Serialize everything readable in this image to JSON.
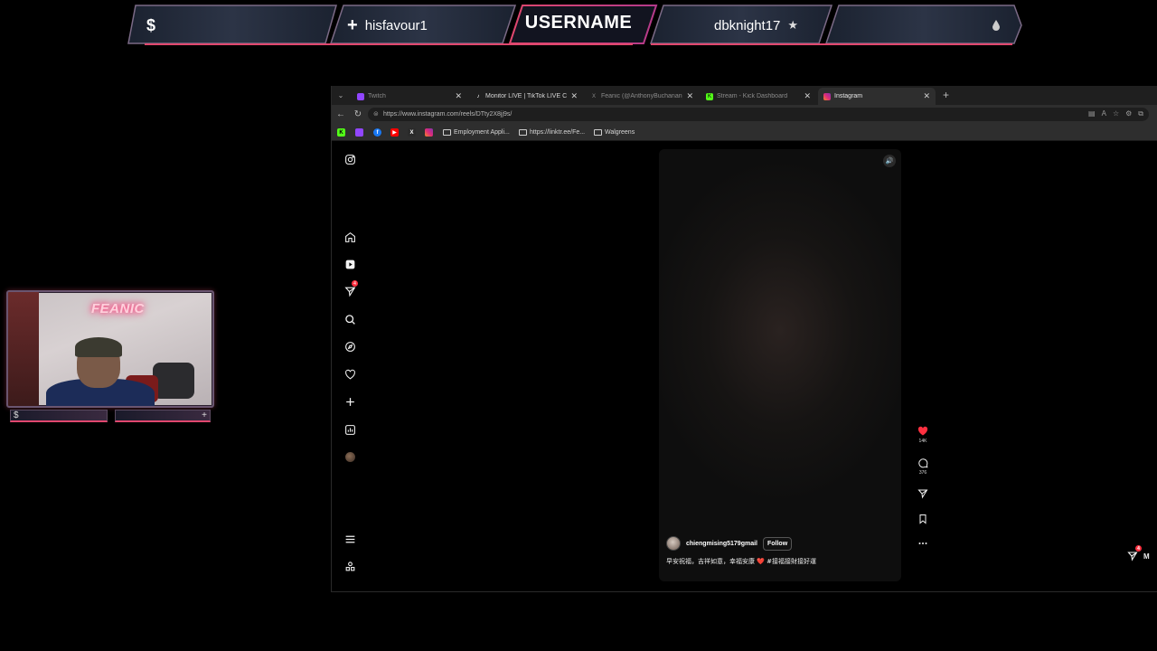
{
  "overlay": {
    "left_icon": "$",
    "follower_prefix": "+",
    "follower_name": "hisfavour1",
    "username": "USERNAME",
    "subscriber_name": "dbknight17",
    "subscriber_icon": "★",
    "right_icon": "💧"
  },
  "webcam": {
    "neon_sign": "FEANIC",
    "footer_left_icon": "$",
    "footer_right_icon": "+"
  },
  "browser": {
    "tabs": [
      {
        "label": "Twitch",
        "favicon": "twitch-icon",
        "fav_color": "#9146ff"
      },
      {
        "label": "Monitor LIVE | TikTok LIVE Center",
        "favicon": "tiktok-icon",
        "fav_color": "#ffffff"
      },
      {
        "label": "Feanic (@AnthonyBuchanan) / X",
        "favicon": "x-icon",
        "fav_color": "#888888"
      },
      {
        "label": "Stream - Kick Dashboard",
        "favicon": "kick-icon",
        "fav_color": "#53fc18"
      },
      {
        "label": "Instagram",
        "favicon": "instagram-icon",
        "fav_color": "#e1306c"
      }
    ],
    "new_tab": "+",
    "url": "https://www.instagram.com/reels/DTty2X8jj9s/",
    "bookmarks": {
      "folders": [
        "Employment Appli...",
        "https://linktr.ee/Fe...",
        "Walgreens"
      ]
    }
  },
  "instagram": {
    "reel": {
      "username": "chiengmising5179gmail",
      "follow_label": "Follow",
      "caption": "早安祝福，吉祥如意，幸福安康 ❤️ #接福接財接好運"
    },
    "likes": "14K",
    "comments": "376",
    "notifications_badge": "4",
    "messages_badge": "4",
    "messages_label": "M"
  }
}
